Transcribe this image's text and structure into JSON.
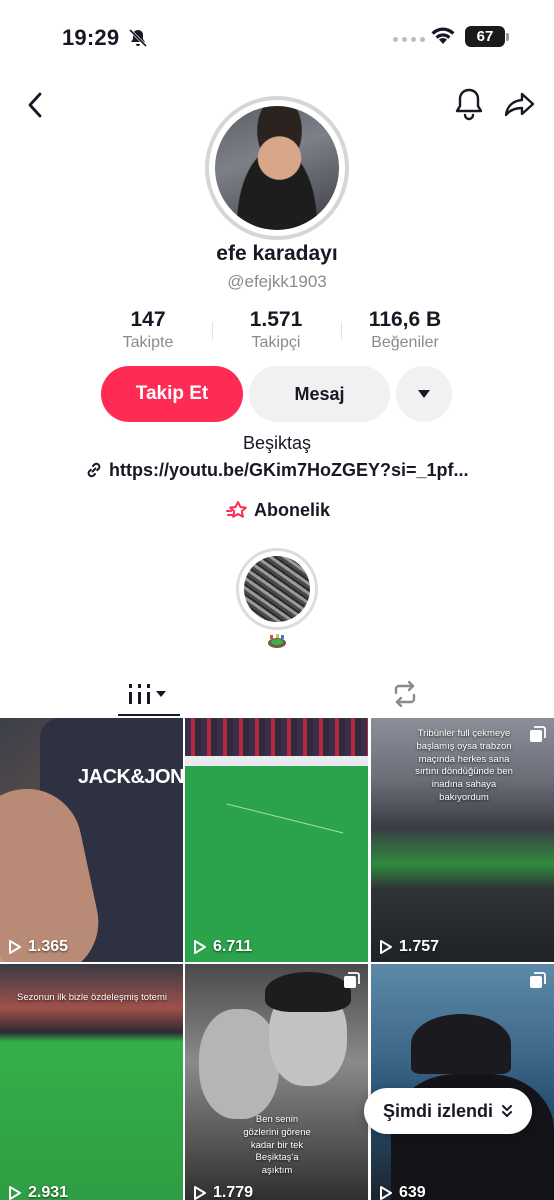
{
  "status_bar": {
    "time": "19:29",
    "battery": "67"
  },
  "profile": {
    "display_name": "efe karadayı",
    "username": "@efejkk1903",
    "stats": [
      {
        "value": "147",
        "label": "Takipte"
      },
      {
        "value": "1.571",
        "label": "Takipçi"
      },
      {
        "value": "116,6 B",
        "label": "Beğeniler"
      }
    ],
    "follow_label": "Takip Et",
    "message_label": "Mesaj",
    "bio": "Beşiktaş",
    "link": "https://youtu.be/GKim7HoZGEY?si=_1pf...",
    "subscription_label": "Abonelik"
  },
  "videos": [
    {
      "views": "1.365",
      "caption": "",
      "brand_text": "JACK&JONES"
    },
    {
      "views": "6.711",
      "caption": ""
    },
    {
      "views": "1.757",
      "caption": "Tribünler full çekmeye başlamış oysa trabzon maçında herkes sana sırtını döndüğünde ben inadına sahaya bakıyordum"
    },
    {
      "views": "2.931",
      "caption": "Sezonun ilk bizle özdeleşmiş totemi"
    },
    {
      "views": "1.779",
      "caption": "Ben senin gözlerini görene kadar bir tek Beşiktaş'a aşıktım"
    },
    {
      "views": "639",
      "caption": ""
    }
  ],
  "now_watched_label": "Şimdi izlendi",
  "colors": {
    "accent": "#fe2c55",
    "text": "#161823",
    "muted": "#8a8b91"
  }
}
